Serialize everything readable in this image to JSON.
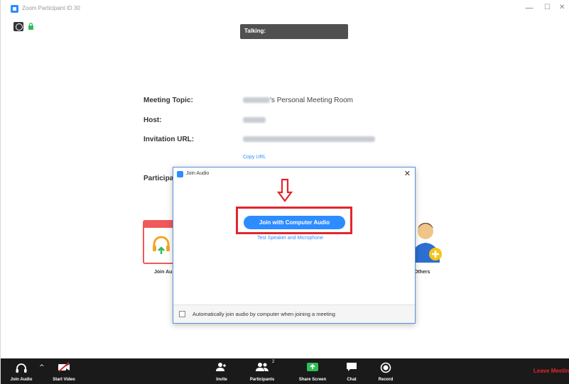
{
  "window": {
    "title": "Zoom Participant ID 30",
    "minimize": "—",
    "maximize": "☐",
    "close": "✕"
  },
  "talking_label": "Talking:",
  "meeting_info": {
    "topic_label": "Meeting Topic:",
    "topic_suffix": "'s Personal Meeting Room",
    "host_label": "Host:",
    "url_label": "Invitation URL:",
    "copy_url": "Copy URL",
    "participant_label": "Participa"
  },
  "tiles": {
    "join_audio_label": "Join Au",
    "invite_label": "e Others"
  },
  "dialog": {
    "title": "Join Audio",
    "close": "✕",
    "join_button": "Join with Computer Audio",
    "test_link": "Test Speaker and Microphone",
    "auto_join_text": "Automatically join audio by computer when joining a meeting",
    "auto_join_checked": false
  },
  "toolbar": {
    "join_audio": "Join Audio",
    "start_video": "Start Video",
    "invite": "Invite",
    "participants": "Participants",
    "participants_count": "2",
    "share_screen": "Share Screen",
    "chat": "Chat",
    "record": "Record",
    "leave": "Leave Meeting"
  },
  "colors": {
    "accent": "#2d8cff",
    "highlight": "#e3262b",
    "toolbar_bg": "#1a1a1a",
    "share_green": "#2ebd59"
  }
}
